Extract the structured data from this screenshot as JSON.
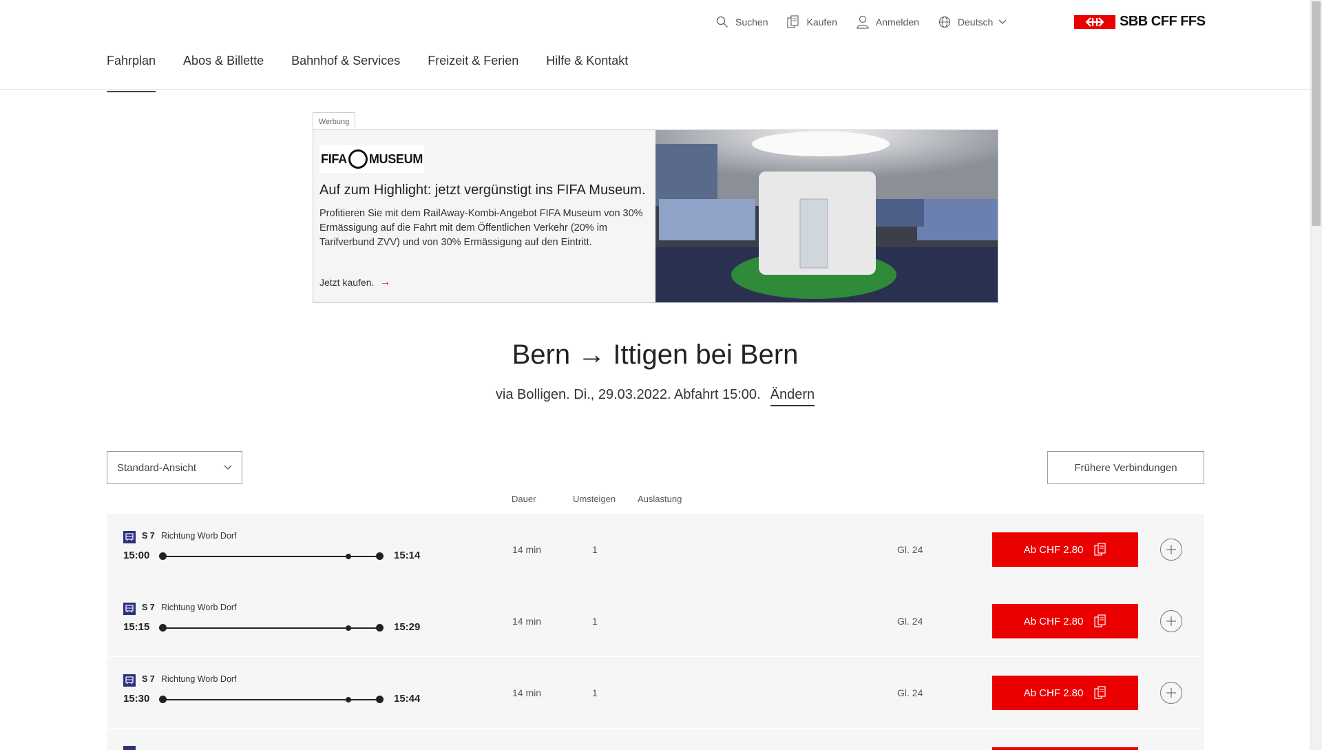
{
  "header": {
    "meta_nav": {
      "search": "Suchen",
      "buy": "Kaufen",
      "login": "Anmelden",
      "language": "Deutsch"
    },
    "logo_text": "SBB CFF FFS",
    "main_nav": [
      "Fahrplan",
      "Abos & Billette",
      "Bahnhof & Services",
      "Freizeit & Ferien",
      "Hilfe & Kontakt"
    ],
    "active_nav": "Fahrplan"
  },
  "ad": {
    "tag": "Werbung",
    "logo_left": "FIFA",
    "logo_right": "MUSEUM",
    "title": "Auf zum Highlight: jetzt vergünstigt ins FIFA Museum.",
    "body": "Profitieren Sie mit dem RailAway-Kombi-Angebot FIFA Museum von 30% Ermässigung auf die Fahrt mit dem Öffentlichen Verkehr (20% im Tarifverbund ZVV) und von 30% Ermässigung auf den Eintritt.",
    "cta": "Jetzt kaufen."
  },
  "route": {
    "title": "Bern → Ittigen bei Bern",
    "subtitle": "via Bolligen. Di., 29.03.2022. Abfahrt 15:00.",
    "change_link": "Ändern"
  },
  "controls": {
    "view_select": "Standard-Ansicht",
    "earlier_button": "Frühere Verbindungen"
  },
  "columns": {
    "duration": "Dauer",
    "changes": "Umsteigen",
    "occupancy": "Auslastung"
  },
  "connections": [
    {
      "line": "S 7",
      "direction": "Richtung Worb Dorf",
      "departure": "15:00",
      "arrival": "15:14",
      "duration": "14 min",
      "changes": "1",
      "platform": "Gl. 24",
      "price": "Ab CHF 2.80"
    },
    {
      "line": "S 7",
      "direction": "Richtung Worb Dorf",
      "departure": "15:15",
      "arrival": "15:29",
      "duration": "14 min",
      "changes": "1",
      "platform": "Gl. 24",
      "price": "Ab CHF 2.80"
    },
    {
      "line": "S 7",
      "direction": "Richtung Worb Dorf",
      "departure": "15:30",
      "arrival": "15:44",
      "duration": "14 min",
      "changes": "1",
      "platform": "Gl. 24",
      "price": "Ab CHF 2.80"
    }
  ],
  "colors": {
    "brand_red": "#eb0000",
    "train_icon_blue": "#2d327d",
    "row_background": "#f6f6f6"
  }
}
